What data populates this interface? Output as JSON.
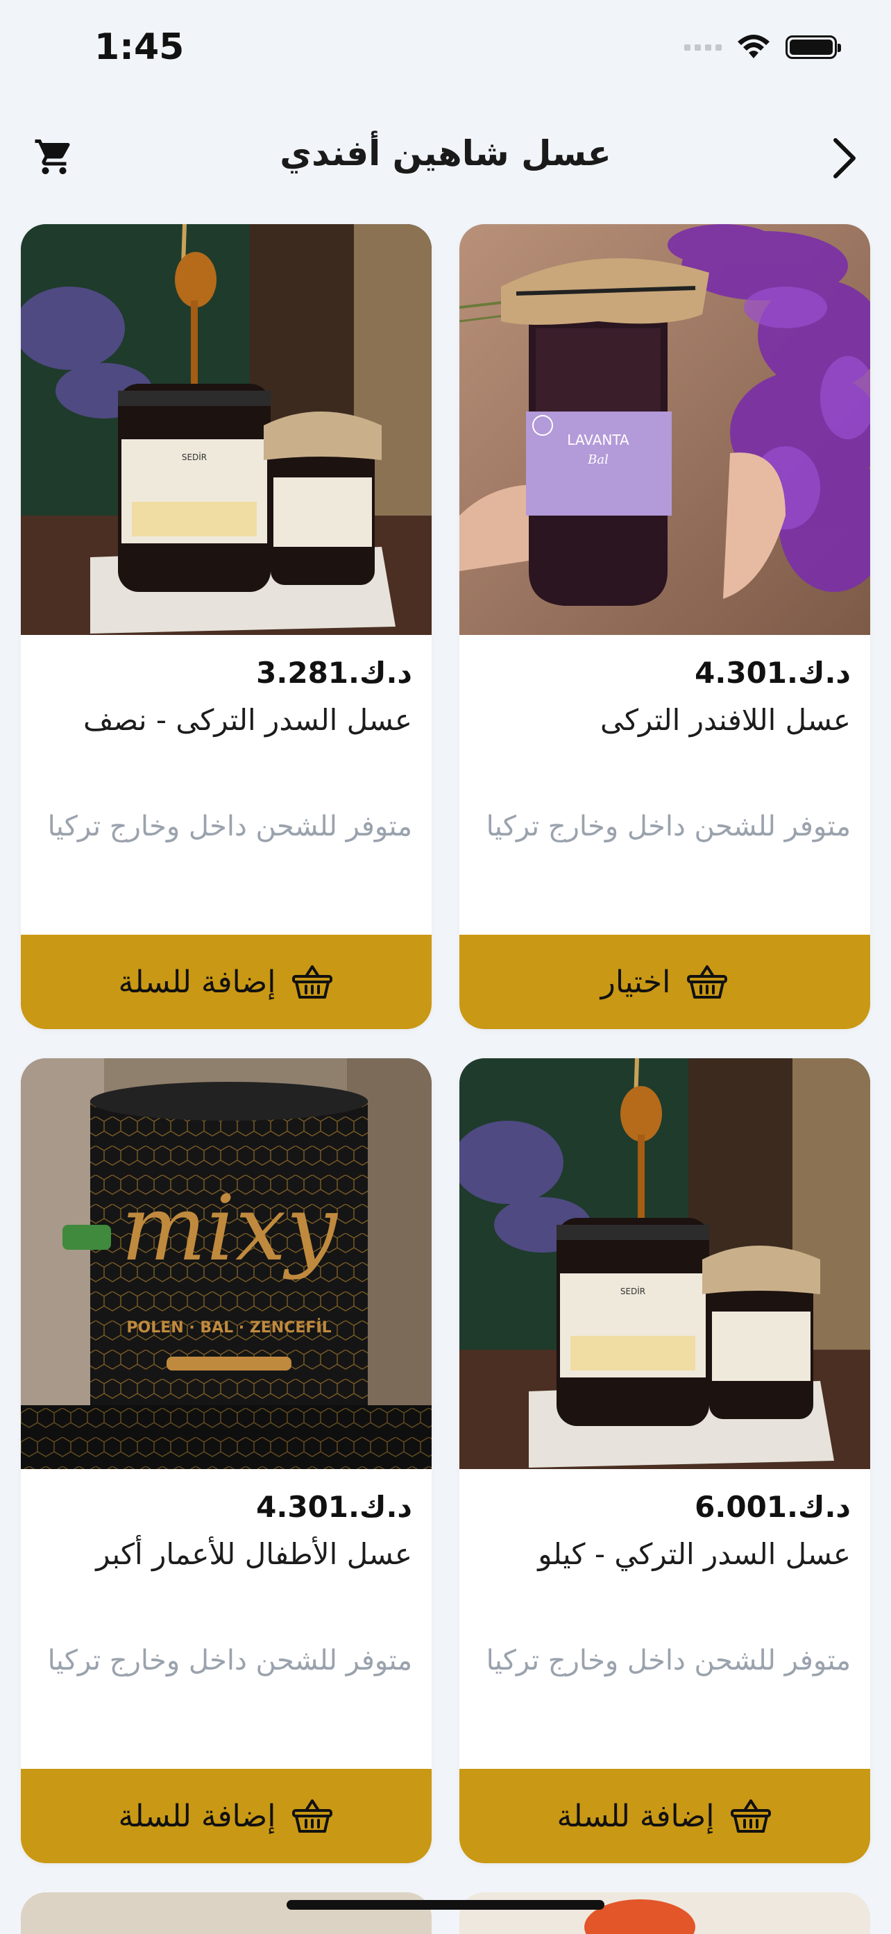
{
  "status_bar": {
    "time": "1:45"
  },
  "header": {
    "title": "عسل شاهين أفندي",
    "cart_icon": "cart-icon",
    "back_icon": "chevron-right-icon"
  },
  "products": [
    {
      "price": "د.ك.4.301",
      "name": "عسل اللافندر التركى",
      "availability": "متوفر للشحن داخل وخارج تركيا",
      "button_label": "اختيار",
      "jar_label_top": "LAVANTA",
      "jar_label_sub": "Bal"
    },
    {
      "price": "د.ك.3.281",
      "name": "عسل السدر التركى - نصف",
      "availability": "متوفر للشحن داخل وخارج تركيا",
      "button_label": "إضافة للسلة",
      "jar_label_top": "SEDİR"
    },
    {
      "price": "د.ك.6.001",
      "name": "عسل السدر التركي - كيلو",
      "availability": "متوفر للشحن داخل وخارج تركيا",
      "button_label": "إضافة للسلة",
      "jar_label_top": "SEDİR"
    },
    {
      "price": "د.ك.4.301",
      "name": "عسل الأطفال للأعمار أكبر",
      "availability": "متوفر للشحن داخل وخارج تركيا",
      "button_label": "إضافة للسلة",
      "jar_label_top": "mixy",
      "jar_label_sub": "POLEN · BAL · ZENCEFİL"
    }
  ],
  "colors": {
    "accent": "#c99814",
    "background": "#f1f4f8",
    "muted_text": "#9aa2ad"
  }
}
